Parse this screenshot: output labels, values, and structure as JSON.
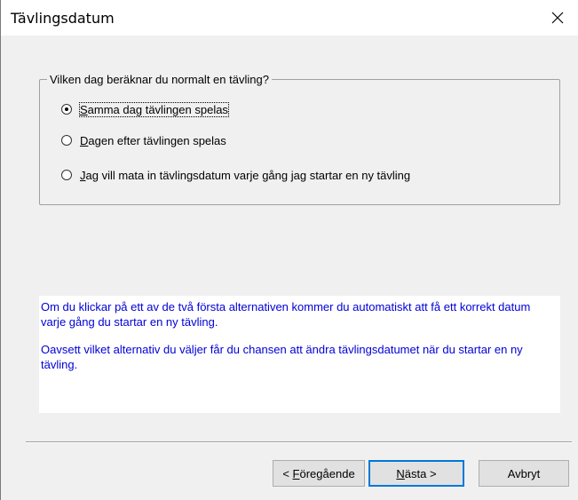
{
  "window": {
    "title": "Tävlingsdatum",
    "close_label": "×"
  },
  "group": {
    "legend": "Vilken dag beräknar du normalt en tävling?",
    "options": [
      {
        "label": "Samma dag tävlingen spelas",
        "checked": true,
        "mnemonic": "S"
      },
      {
        "label": "Dagen efter tävlingen spelas",
        "checked": false,
        "mnemonic": "D"
      },
      {
        "label": "Jag vill mata in tävlingsdatum varje gång jag startar en ny tävling",
        "checked": false,
        "mnemonic": "J"
      }
    ]
  },
  "info": {
    "paragraph1": "Om du klickar på ett av de två första alternativen kommer du automatiskt att få ett korrekt datum varje gång du startar en ny tävling.",
    "paragraph2": "Oavsett vilket alternativ du väljer får du chansen att ändra tävlingsdatumet när du startar en ny tävling.",
    "text_color": "#0000d8"
  },
  "buttons": {
    "prev": {
      "prefix": "< ",
      "mnemonic": "F",
      "rest": "öregående"
    },
    "next": {
      "mnemonic": "N",
      "rest": "ästa >"
    },
    "cancel": "Avbryt"
  },
  "colors": {
    "accent": "#0078d7",
    "dialog_bg": "#f0f0f0"
  }
}
